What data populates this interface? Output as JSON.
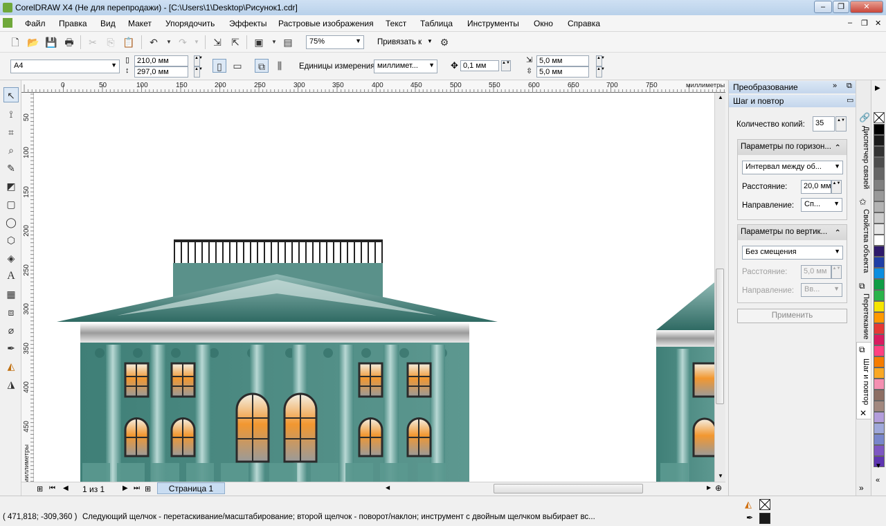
{
  "window": {
    "title": "CorelDRAW X4 (Не для перепродажи) - [C:\\Users\\1\\Desktop\\Рисунок1.cdr]"
  },
  "menu": [
    "Файл",
    "Правка",
    "Вид",
    "Макет",
    "Упорядочить",
    "Эффекты",
    "Растровые изображения",
    "Текст",
    "Таблица",
    "Инструменты",
    "Окно",
    "Справка"
  ],
  "std_toolbar": {
    "zoom": "75%",
    "snap_label": "Привязать к"
  },
  "property_bar": {
    "page_size": "A4",
    "width": "210,0 мм",
    "height": "297,0 мм",
    "units_label": "Единицы измерения:",
    "units": "миллимет...",
    "nudge": "0,1 мм",
    "dup_x": "5,0 мм",
    "dup_y": "5,0 мм"
  },
  "ruler": {
    "h_ticks": [
      "0",
      "50",
      "100",
      "150",
      "200",
      "250",
      "300",
      "350",
      "400",
      "450",
      "500",
      "550",
      "600",
      "650",
      "700",
      "750"
    ],
    "h_unit": "миллиметры",
    "v_ticks": [
      "50",
      "100",
      "150",
      "200",
      "250",
      "300",
      "350",
      "400",
      "450"
    ],
    "v_unit": "миллиметры"
  },
  "page_nav": {
    "count": "1 из 1",
    "tab": "Страница 1"
  },
  "docker": {
    "header_title": "Преобразование",
    "panel_title": "Шаг и повтор",
    "copies_label": "Количество копий:",
    "copies": "35",
    "horizontal": {
      "title": "Параметры по горизон...",
      "mode": "Интервал между об...",
      "distance_label": "Расстояние:",
      "distance": "20,0 мм",
      "direction_label": "Направление:",
      "direction": "Сп..."
    },
    "vertical": {
      "title": "Параметры по вертик...",
      "mode": "Без смещения",
      "distance_label": "Расстояние:",
      "distance": "5,0 мм",
      "direction_label": "Направление:",
      "direction": "Вв..."
    },
    "apply": "Применить"
  },
  "side_tabs": [
    "Диспетчер связей",
    "Свойства объекта",
    "Перетекание",
    "Шаг и повтор"
  ],
  "palette": [
    "#ffffff",
    "#000000",
    "#1a1a1a",
    "#333333",
    "#4d4d4d",
    "#666666",
    "#808080",
    "#999999",
    "#b3b3b3",
    "#cccccc",
    "#e6e6e6",
    "#ffffff",
    "#2e1a6b",
    "#1f3fa6",
    "#0b8ee0",
    "#0f9d45",
    "#2bb34a",
    "#f5e400",
    "#ff9800",
    "#e53935",
    "#d81b60",
    "#ff4081",
    "#f57c00",
    "#f9a825",
    "#f48fb1",
    "#8d6e63",
    "#a1887f",
    "#b39ddb",
    "#9fa8da",
    "#7986cb",
    "#7e57c2",
    "#5e35b1"
  ],
  "status": {
    "coords": "( 471,818; -309,360 )",
    "message": "Следующий щелчок - перетаскивание/масштабирование; второй щелчок - поворот/наклон; инструмент с двойным щелчком выбирает вс..."
  }
}
